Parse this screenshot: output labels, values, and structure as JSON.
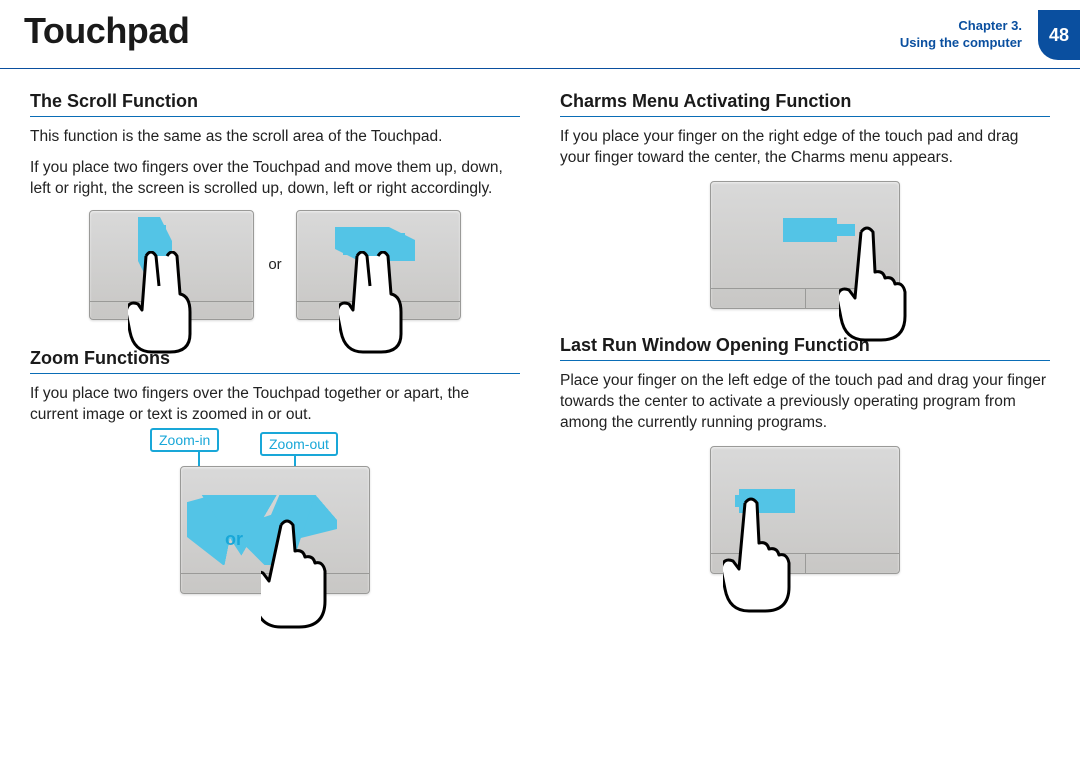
{
  "header": {
    "title": "Touchpad",
    "chapter_line1": "Chapter 3.",
    "chapter_line2": "Using the computer",
    "page_number": "48"
  },
  "left": {
    "scroll": {
      "heading": "The Scroll Function",
      "p1": "This function is the same as the scroll area of the Touchpad.",
      "p2": "If you place two fingers over the Touchpad and move them up, down, left or right, the screen is scrolled up, down, left or right accordingly.",
      "or": "or"
    },
    "zoom": {
      "heading": "Zoom Functions",
      "p1": "If you place two fingers over the Touchpad together or apart, the current image or text is zoomed in or out.",
      "zoom_in_label": "Zoom-in",
      "zoom_out_label": "Zoom-out",
      "or": "or"
    }
  },
  "right": {
    "charms": {
      "heading": "Charms Menu Activating Function",
      "p1": "If you place your finger on the right edge of the touch pad and drag your finger toward the center, the Charms menu appears."
    },
    "lastrun": {
      "heading": "Last Run Window Opening Function",
      "p1": "Place your finger on the left edge of the touch pad and drag your finger towards the center to activate a previously operating program from among the currently running programs."
    }
  }
}
